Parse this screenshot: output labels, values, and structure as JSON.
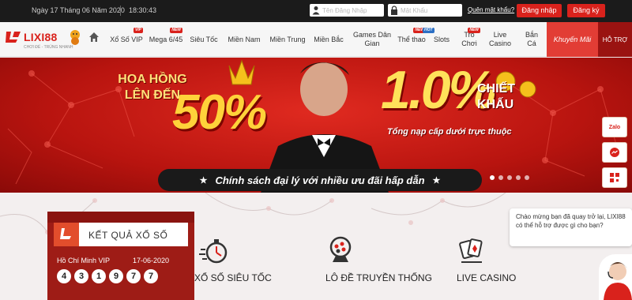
{
  "topbar": {
    "date": "Ngày 17 Tháng 06 Năm 2020",
    "time": "18:30:43",
    "username_placeholder": "Tên Đăng Nhập",
    "password_placeholder": "Mật Khẩu",
    "forgot": "Quên mật khẩu?",
    "login": "Đăng nhập",
    "register": "Đăng ký"
  },
  "logo": {
    "name": "LIXI88",
    "tagline": "CHƠI ĐỂ - TRÚNG NHANH"
  },
  "nav": {
    "items": [
      {
        "label": "Xổ Số VIP",
        "badge": "VIP"
      },
      {
        "label": "Mega 6/45",
        "badge": "NEW"
      },
      {
        "label": "Siêu Tốc",
        "badge": ""
      },
      {
        "label": "Miền Nam",
        "badge": ""
      },
      {
        "label": "Miền Trung",
        "badge": ""
      },
      {
        "label": "Miền Bắc",
        "badge": ""
      },
      {
        "label": "Games Dân Gian",
        "badge": ""
      },
      {
        "label": "Thể thao",
        "badge": "NEW"
      },
      {
        "label": "Slots",
        "badge": "HOT"
      },
      {
        "label": "Trò Chơi",
        "badge": "NEW"
      },
      {
        "label": "Live Casino",
        "badge": ""
      },
      {
        "label": "Bắn Cá",
        "badge": ""
      }
    ],
    "promo": "Khuyến Mãi",
    "support": "HỖ TRỢ"
  },
  "banner": {
    "hoa_hong": "HOA HỒNG LÊN ĐẾN",
    "pct_left": "50%",
    "pct_right": "1.0%",
    "chiet_khau": "CHIẾT KHẤU",
    "tong_nap": "Tổng nạp cấp dưới trực thuộc",
    "slogan": "Chính sách đại lý với nhiều ưu đãi hấp dẫn",
    "star": "★"
  },
  "side_tools": {
    "zalo": "Zalo"
  },
  "results": {
    "title": "KẾT QUẢ XỔ SỐ",
    "region": "Hồ Chí Minh VIP",
    "date": "17-06-2020",
    "numbers": [
      "4",
      "3",
      "1",
      "9",
      "7",
      "7"
    ]
  },
  "categories": [
    "XỔ SỐ SIÊU TỐC",
    "LÔ ĐỀ TRUYỀN THỐNG",
    "LIVE CASINO"
  ],
  "chat": {
    "message": "Chào mừng bạn đã quay trở lại, LIXI88 có thể hỗ trợ được gì cho bạn?"
  },
  "colors": {
    "brand_red": "#d9221c",
    "topbar": "#1b1b1b",
    "promo": "#e23d35"
  }
}
